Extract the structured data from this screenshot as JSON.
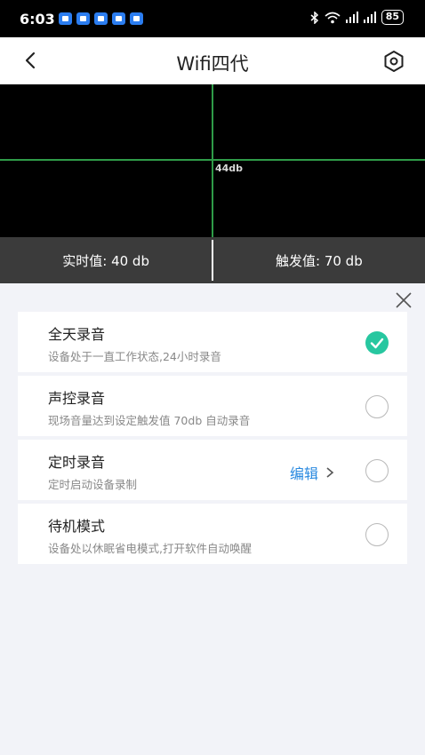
{
  "status_bar": {
    "time": "6:03",
    "battery": "85"
  },
  "header": {
    "title": "Wifi四代"
  },
  "monitor": {
    "line_label": "44db"
  },
  "values": {
    "realtime": "实时值: 40 db",
    "trigger": "触发值: 70 db"
  },
  "options": [
    {
      "title": "全天录音",
      "desc": "设备处于一直工作状态,24小时录音",
      "selected": true
    },
    {
      "title": "声控录音",
      "desc": "现场音量达到设定触发值 70db 自动录音",
      "selected": false
    },
    {
      "title": "定时录音",
      "desc": "定时启动设备录制",
      "selected": false,
      "edit_label": "编辑"
    },
    {
      "title": "待机模式",
      "desc": "设备处以休眠省电模式,打开软件自动唤醒",
      "selected": false
    }
  ],
  "colors": {
    "accent": "#27c7a0",
    "link": "#2a8ae0",
    "grid_line": "#2f9c48"
  }
}
